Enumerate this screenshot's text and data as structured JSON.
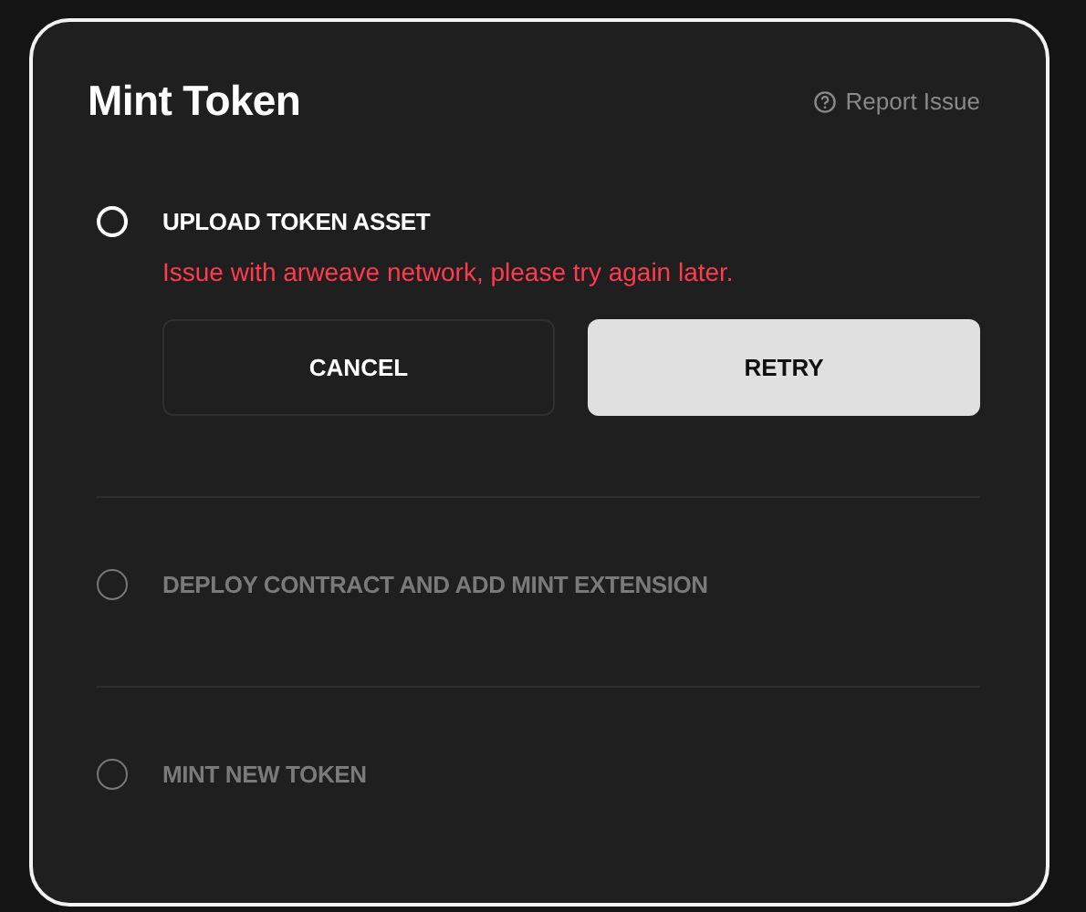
{
  "dialog": {
    "title": "Mint Token",
    "report_link": "Report Issue"
  },
  "steps": [
    {
      "label": "UPLOAD TOKEN ASSET",
      "active": true,
      "checked": false,
      "error": "Issue with arweave network, please try again later.",
      "buttons": [
        {
          "label": "CANCEL",
          "kind": "secondary"
        },
        {
          "label": "RETRY",
          "kind": "primary"
        }
      ]
    },
    {
      "label": "DEPLOY CONTRACT AND ADD MINT EXTENSION",
      "active": false,
      "checked": false
    },
    {
      "label": "MINT NEW TOKEN",
      "active": false,
      "checked": false
    }
  ]
}
